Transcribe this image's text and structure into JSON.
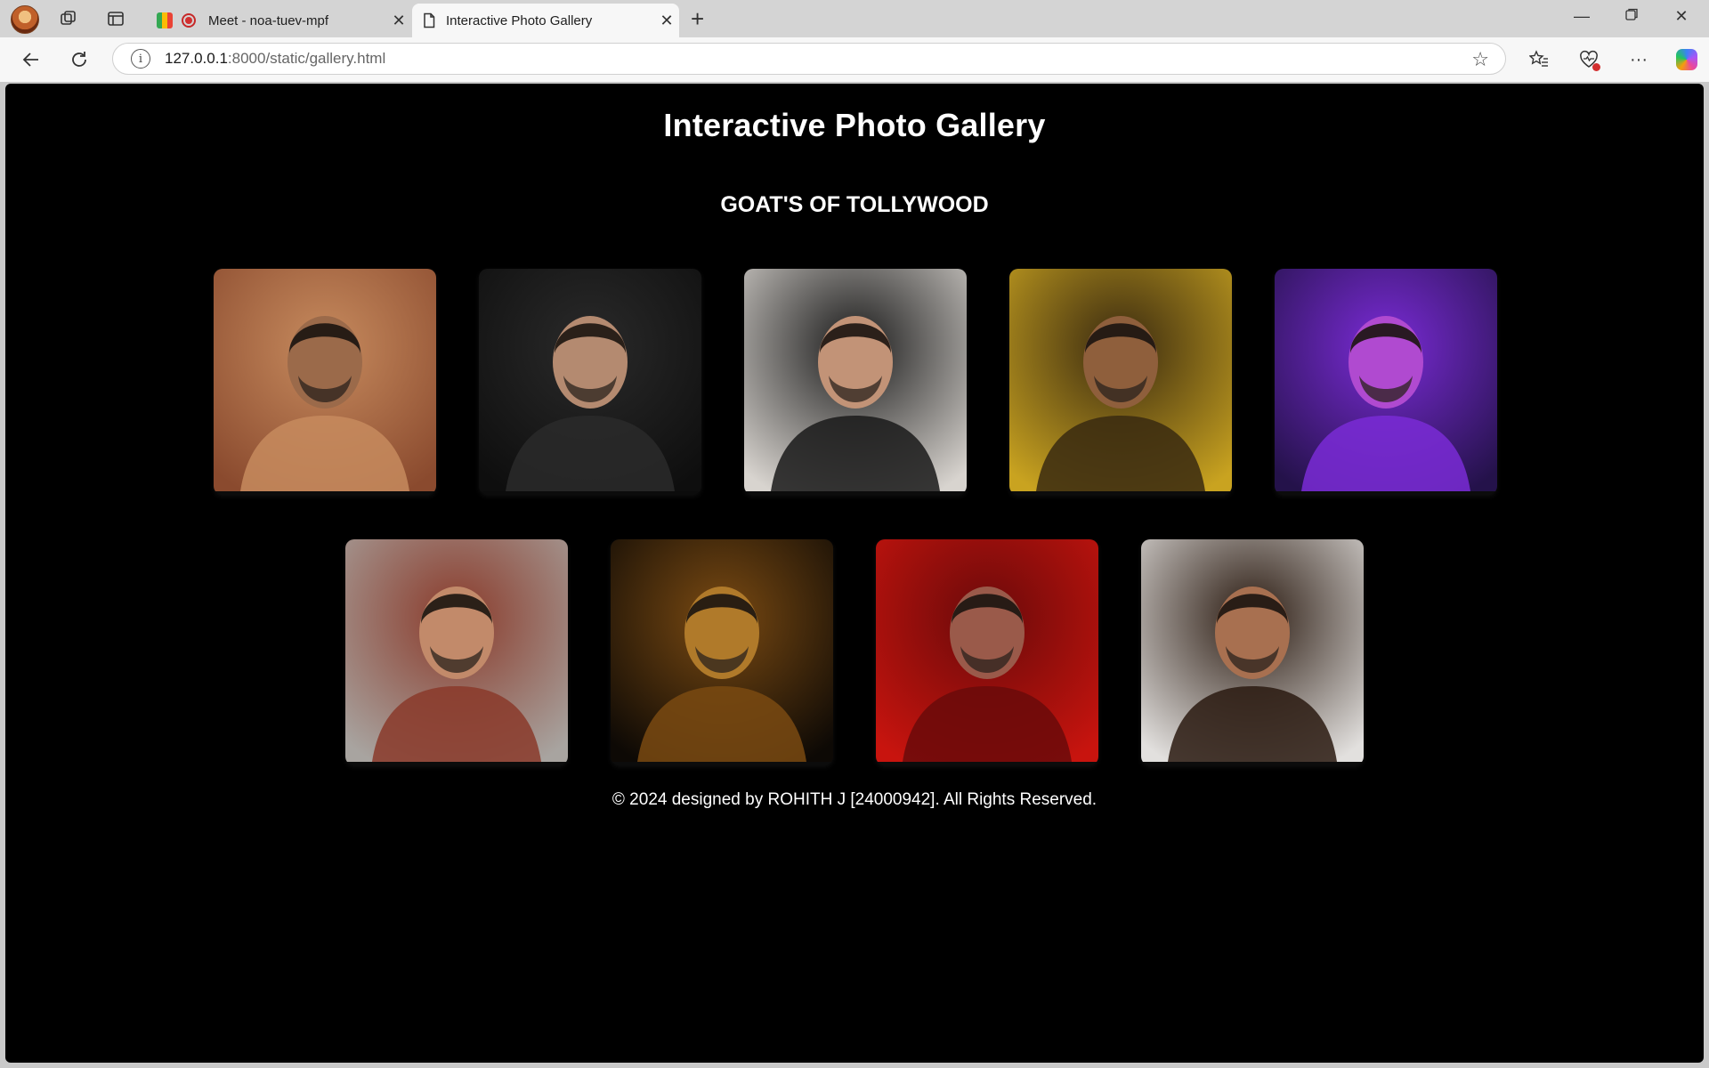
{
  "browser": {
    "tabs": [
      {
        "title": "Meet - noa-tuev-mpf",
        "active": false
      },
      {
        "title": "Interactive Photo Gallery",
        "active": true
      }
    ],
    "address": {
      "host": "127.0.0.1",
      "path": ":8000/static/gallery.html"
    }
  },
  "page": {
    "title": "Interactive Photo Gallery",
    "subtitle": "GOAT'S OF TOLLYWOOD",
    "footer": "© 2024 designed by ROHITH J [24000942]. All Rights Reserved."
  },
  "gallery": [
    {
      "name": "photo-1",
      "bg": "#8a4a2e",
      "accent": "#c78b5e",
      "skin": "#9b6a4a"
    },
    {
      "name": "photo-2",
      "bg": "#0e0e0e",
      "accent": "#2a2a2a",
      "skin": "#b48a70"
    },
    {
      "name": "photo-3",
      "bg": "#d8d4cf",
      "accent": "#1a1a1a",
      "skin": "#c29377"
    },
    {
      "name": "photo-4",
      "bg": "#c9a320",
      "accent": "#3a2a10",
      "skin": "#8f5f3c"
    },
    {
      "name": "photo-5",
      "bg": "#24124a",
      "accent": "#7a2bd6",
      "skin": "#b04ad0"
    },
    {
      "name": "photo-6",
      "bg": "#a8a4a0",
      "accent": "#8a3a2a",
      "skin": "#c28a6a"
    },
    {
      "name": "photo-7",
      "bg": "#0d0905",
      "accent": "#7a4a12",
      "skin": "#b07a2a"
    },
    {
      "name": "photo-8",
      "bg": "#c8140e",
      "accent": "#6a0a0a",
      "skin": "#9a5a4a"
    },
    {
      "name": "photo-9",
      "bg": "#e2e0de",
      "accent": "#2a1a10",
      "skin": "#a87050"
    }
  ]
}
